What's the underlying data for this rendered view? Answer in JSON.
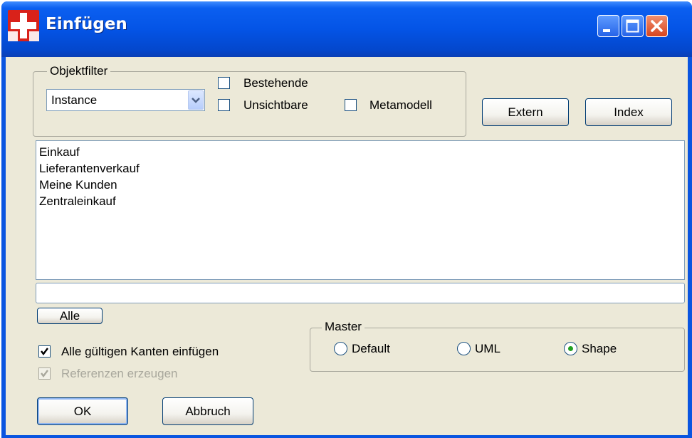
{
  "window": {
    "title": "Einfügen",
    "controls": [
      "minimize-icon",
      "maximize-icon",
      "close-icon"
    ]
  },
  "objektfilter": {
    "legend": "Objektfilter",
    "select": {
      "value": "Instance"
    },
    "checkboxes": [
      {
        "label": "Bestehende",
        "checked": false
      },
      {
        "label": "Unsichtbare",
        "checked": false
      },
      {
        "label": "Metamodell",
        "checked": false
      }
    ]
  },
  "buttons": {
    "extern": "Extern",
    "index": "Index",
    "alle": "Alle",
    "ok": "OK",
    "abbruch": "Abbruch"
  },
  "list": {
    "items": [
      "Einkauf",
      "Lieferantenverkauf",
      "Meine Kunden",
      "Zentraleinkauf"
    ]
  },
  "filter_input": {
    "value": ""
  },
  "options": {
    "alle_kanten": {
      "label": "Alle gültigen Kanten einfügen",
      "checked": true
    },
    "referenzen": {
      "label": "Referenzen erzeugen",
      "checked": true,
      "disabled": true
    }
  },
  "master": {
    "legend": "Master",
    "options": [
      {
        "label": "Default",
        "selected": false
      },
      {
        "label": "UML",
        "selected": false
      },
      {
        "label": "Shape",
        "selected": true
      }
    ]
  },
  "colors": {
    "titlebar": "#0454e6",
    "dialog_bg": "#ece9d8",
    "close_button": "#d8451e",
    "radio_dot": "#21a121"
  }
}
